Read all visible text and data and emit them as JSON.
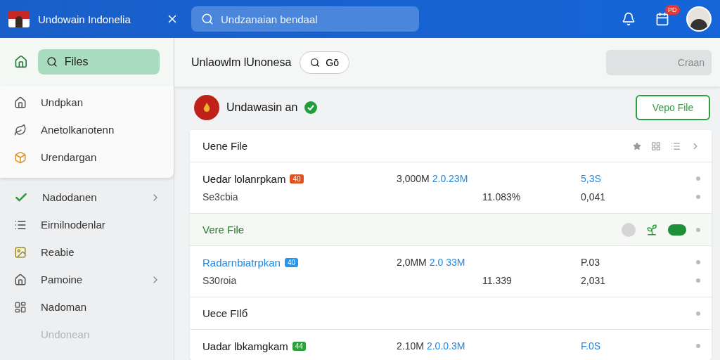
{
  "topbar": {
    "title": "Undowain Indonelia",
    "search": {
      "placeholder": "Undzanaian bendaal"
    },
    "notification_count": "PD"
  },
  "sidebar": {
    "search_button": {
      "label": "Files",
      "selected": true
    },
    "pinned": [
      {
        "label": "Undpkan"
      },
      {
        "label": "Anetolkanotenn"
      },
      {
        "label": "Urendargan"
      }
    ],
    "items": [
      {
        "label": "Nadodanen",
        "has_submenu": true,
        "disabled": false
      },
      {
        "label": "Eirnilnodenlar",
        "has_submenu": false,
        "disabled": false
      },
      {
        "label": "Reabie",
        "has_submenu": false,
        "disabled": false
      },
      {
        "label": "Pamoine",
        "has_submenu": true,
        "disabled": false
      },
      {
        "label": "Nadoman",
        "has_submenu": false,
        "disabled": false
      },
      {
        "label": "Undonean",
        "has_submenu": false,
        "disabled": true
      }
    ]
  },
  "toolbar": {
    "title": "Unlaowlm lUnonesa",
    "go_button": "Gō",
    "create_button": {
      "label": "Craan",
      "disabled": true
    }
  },
  "profile": {
    "name": "Undawasin  an",
    "verified": true,
    "action_button": "Vepo File"
  },
  "rows": [
    {
      "kind": "group",
      "label": "Uene File",
      "highlight": false
    },
    {
      "kind": "file",
      "name": "Uedar lolanrpkam",
      "badge": "40",
      "color": "#e0531f",
      "highlight": false,
      "size_a": "3,000M",
      "size_b": "2.0.23M",
      "value": "5,3S",
      "sub": "Se3cbia",
      "percent": "11.083%",
      "sub_value": "0,041"
    },
    {
      "kind": "group",
      "label": "Vere File",
      "highlight": true
    },
    {
      "kind": "file",
      "name": "Radarnbiatrpkan",
      "badge": "40",
      "color": "#2196f3",
      "highlight": true,
      "size_a": "2,0MM",
      "size_b": "2.0 33M",
      "value": "P.03",
      "sub": "S30roia",
      "percent": "11.339",
      "sub_value": "2,031"
    },
    {
      "kind": "group",
      "label": "Uece FIlб",
      "highlight": false
    },
    {
      "kind": "file",
      "name": "Uadar lbkamgkam",
      "badge": "44",
      "color": "#2e9e3e",
      "highlight": false,
      "size_a": "2.10M",
      "size_b": "2.0.0.3M",
      "value": "F.0S"
    }
  ]
}
